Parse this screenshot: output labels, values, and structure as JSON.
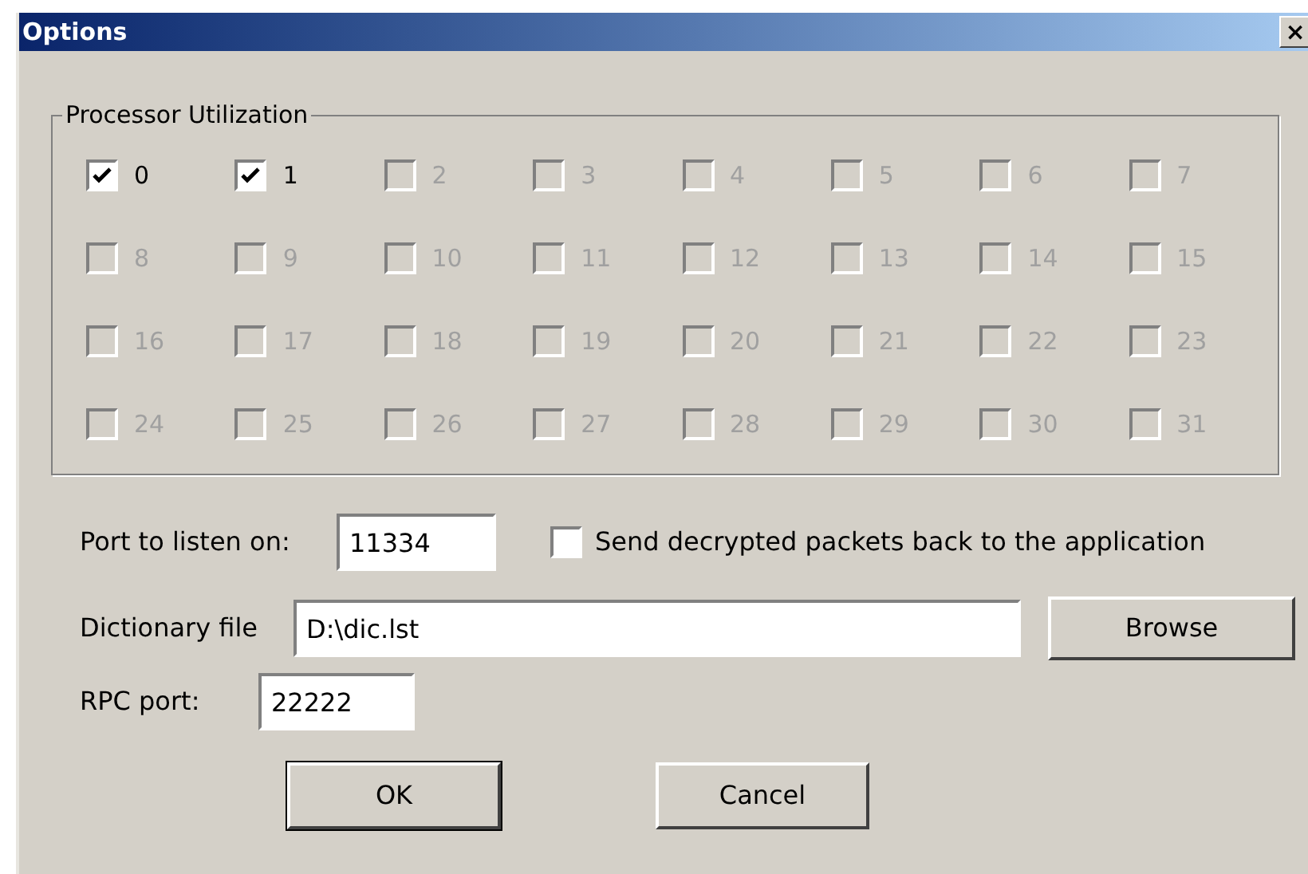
{
  "window": {
    "title": "Options",
    "close": "×"
  },
  "processor_group": {
    "title": "Processor Utilization",
    "cpus": [
      {
        "label": "0",
        "checked": true,
        "disabled": false
      },
      {
        "label": "1",
        "checked": true,
        "disabled": false
      },
      {
        "label": "2",
        "checked": false,
        "disabled": true
      },
      {
        "label": "3",
        "checked": false,
        "disabled": true
      },
      {
        "label": "4",
        "checked": false,
        "disabled": true
      },
      {
        "label": "5",
        "checked": false,
        "disabled": true
      },
      {
        "label": "6",
        "checked": false,
        "disabled": true
      },
      {
        "label": "7",
        "checked": false,
        "disabled": true
      },
      {
        "label": "8",
        "checked": false,
        "disabled": true
      },
      {
        "label": "9",
        "checked": false,
        "disabled": true
      },
      {
        "label": "10",
        "checked": false,
        "disabled": true
      },
      {
        "label": "11",
        "checked": false,
        "disabled": true
      },
      {
        "label": "12",
        "checked": false,
        "disabled": true
      },
      {
        "label": "13",
        "checked": false,
        "disabled": true
      },
      {
        "label": "14",
        "checked": false,
        "disabled": true
      },
      {
        "label": "15",
        "checked": false,
        "disabled": true
      },
      {
        "label": "16",
        "checked": false,
        "disabled": true
      },
      {
        "label": "17",
        "checked": false,
        "disabled": true
      },
      {
        "label": "18",
        "checked": false,
        "disabled": true
      },
      {
        "label": "19",
        "checked": false,
        "disabled": true
      },
      {
        "label": "20",
        "checked": false,
        "disabled": true
      },
      {
        "label": "21",
        "checked": false,
        "disabled": true
      },
      {
        "label": "22",
        "checked": false,
        "disabled": true
      },
      {
        "label": "23",
        "checked": false,
        "disabled": true
      },
      {
        "label": "24",
        "checked": false,
        "disabled": true
      },
      {
        "label": "25",
        "checked": false,
        "disabled": true
      },
      {
        "label": "26",
        "checked": false,
        "disabled": true
      },
      {
        "label": "27",
        "checked": false,
        "disabled": true
      },
      {
        "label": "28",
        "checked": false,
        "disabled": true
      },
      {
        "label": "29",
        "checked": false,
        "disabled": true
      },
      {
        "label": "30",
        "checked": false,
        "disabled": true
      },
      {
        "label": "31",
        "checked": false,
        "disabled": true
      }
    ]
  },
  "port": {
    "label": "Port to listen on:",
    "value": "11334"
  },
  "send_back": {
    "label": "Send decrypted packets back to the application",
    "checked": false
  },
  "dictionary": {
    "label": "Dictionary file",
    "value": "D:\\dic.lst",
    "browse": "Browse"
  },
  "rpc": {
    "label": "RPC port:",
    "value": "22222"
  },
  "buttons": [
    {
      "label": "OK",
      "default": true
    },
    {
      "label": "Cancel",
      "default": false
    }
  ]
}
